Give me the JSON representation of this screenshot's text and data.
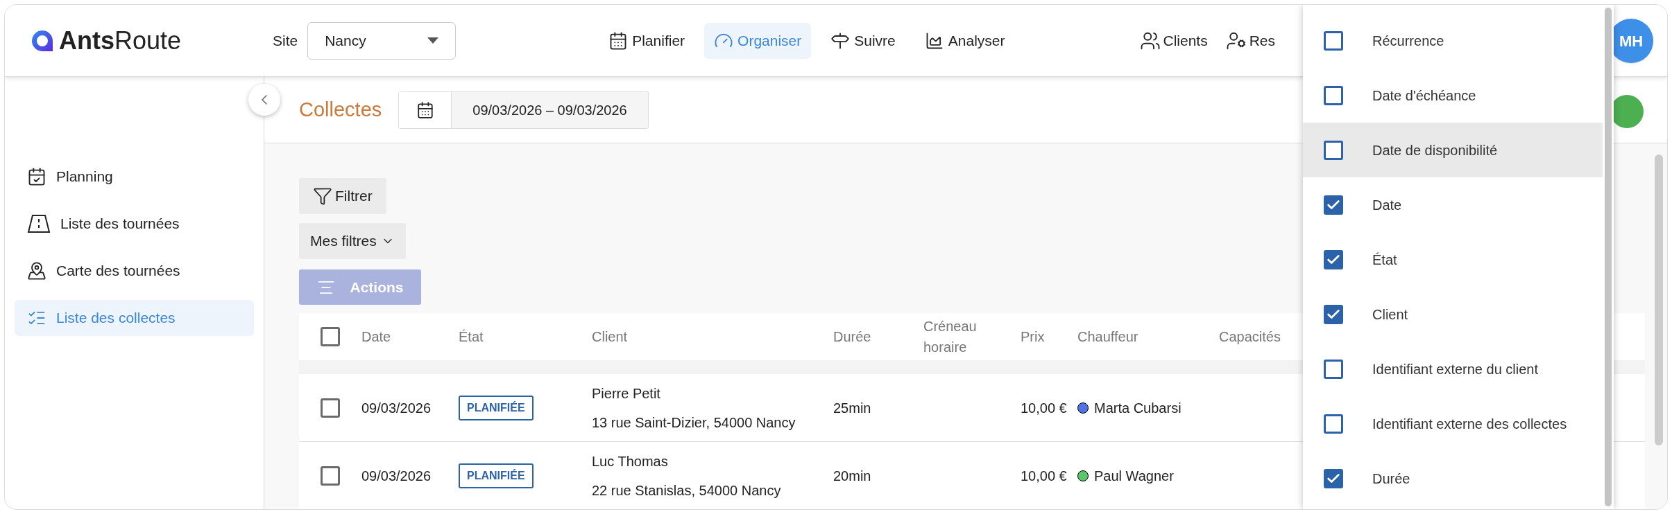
{
  "header": {
    "logo": "**Ants**Route",
    "site": {
      "label": "Site",
      "value": "Nancy"
    },
    "nav": [
      {
        "label": "Planifier",
        "selected": false
      },
      {
        "label": "Organiser",
        "selected": true
      },
      {
        "label": "Suivre",
        "selected": false
      },
      {
        "label": "Analyser",
        "selected": false
      }
    ],
    "right_nav": [
      {
        "label": "Clients"
      },
      {
        "label": "Res"
      }
    ],
    "avatar": "MH"
  },
  "sidebar": {
    "items": [
      {
        "label": "Planning",
        "selected": false
      },
      {
        "label": "Liste des tournées",
        "selected": false
      },
      {
        "label": "Carte des tournées",
        "selected": false
      },
      {
        "label": "Liste des collectes",
        "selected": true
      }
    ]
  },
  "page": {
    "title": "Collectes",
    "date_range": "09/03/2026 – 09/03/2026"
  },
  "toolbar": {
    "filter": "Filtrer",
    "my_filters": "Mes filtres",
    "actions": {
      "label": "Actions",
      "disabled": true
    }
  },
  "table": {
    "columns": [
      "Date",
      "État",
      "Client",
      "Durée",
      "Créneau horaire",
      "Prix",
      "Chauffeur",
      "Capacités"
    ],
    "select_all_checked": false,
    "rows": [
      {
        "checked": false,
        "date": "09/03/2026",
        "status": "PLANIFIÉE",
        "client": "Pierre Petit",
        "address": "13 rue Saint-Dizier, 54000 Nancy",
        "duration": "25min",
        "price": "10,00 €",
        "driver": "Marta Cubarsi",
        "color": "#4f73e3"
      },
      {
        "checked": false,
        "date": "09/03/2026",
        "status": "PLANIFIÉE",
        "client": "Luc Thomas",
        "address": "22 rue Stanislas, 54000 Nancy",
        "duration": "20min",
        "price": "10,00 €",
        "driver": "Paul Wagner",
        "color": "#5cc46a"
      }
    ]
  },
  "column_menu": {
    "items": [
      {
        "label": "Récurrence",
        "checked": false,
        "hovered": false
      },
      {
        "label": "Date d'échéance",
        "checked": false,
        "hovered": false
      },
      {
        "label": "Date de disponibilité",
        "checked": false,
        "hovered": true
      },
      {
        "label": "Date",
        "checked": true,
        "hovered": false
      },
      {
        "label": "État",
        "checked": true,
        "hovered": false
      },
      {
        "label": "Client",
        "checked": true,
        "hovered": false
      },
      {
        "label": "Identifiant externe du client",
        "checked": false,
        "hovered": false
      },
      {
        "label": "Identifiant externe des collectes",
        "checked": false,
        "hovered": false
      },
      {
        "label": "Durée",
        "checked": true,
        "hovered": false
      }
    ]
  }
}
